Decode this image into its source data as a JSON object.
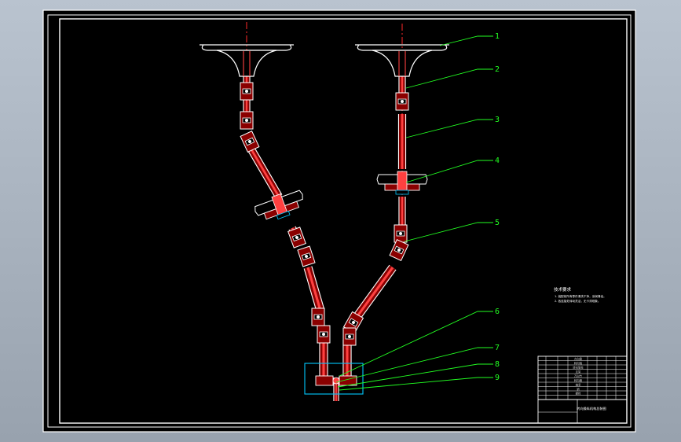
{
  "viewer": {
    "background": "#a9b3bf",
    "sheet_color": "#000000",
    "border_color": "#ffffff"
  },
  "colors": {
    "outline": "#ffffff",
    "centerline": "#ff2a2a",
    "leader": "#22ff22",
    "part_fill": "#ff4040",
    "part_dark": "#8a0000",
    "box_line": "#00c8ff",
    "yellow": "#ffff55",
    "table_text": "#cfcfcf"
  },
  "balloons": [
    "1",
    "2",
    "3",
    "4",
    "5",
    "6",
    "7",
    "8",
    "9"
  ],
  "notes": {
    "heading": "技术要求",
    "lines": [
      "1. 装配前所有零件清洗干净，涂润滑油。",
      "2. 各连接处转动灵活，无卡滞现象。"
    ]
  },
  "title_block": {
    "drawing_title": "转向操纵机构总装图",
    "table_rows": [
      "方向盘",
      "转向轴",
      "转向管柱",
      "支架",
      "万向节",
      "转向器",
      "轴承",
      "销",
      "螺栓"
    ]
  }
}
